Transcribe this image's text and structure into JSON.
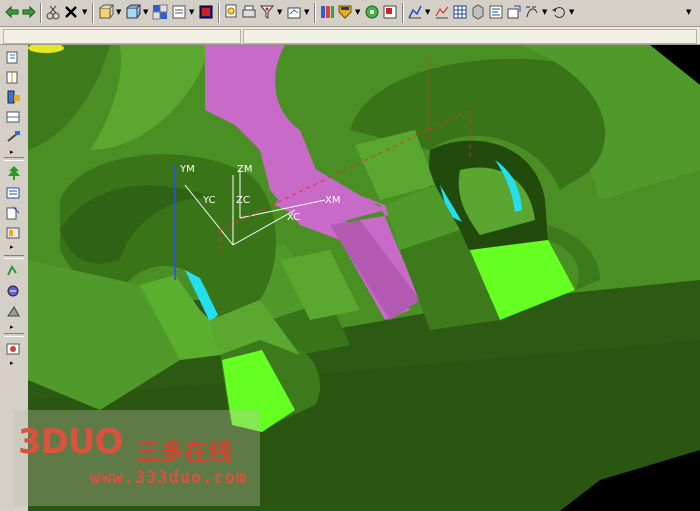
{
  "toolbar": {
    "icons": [
      "undo-icon",
      "redo-icon",
      "cut-icon",
      "delete-icon",
      "orient-view-icon",
      "fit-view-icon",
      "layer-icon",
      "display-mode-icon",
      "shading-icon",
      "zoom-icon",
      "print-icon",
      "filter-icon",
      "snap-icon",
      "column-icon",
      "material-icon",
      "web-icon",
      "edit-icon",
      "chart-icon",
      "spreadsheet-icon",
      "database-icon",
      "table-icon",
      "dimension-icon",
      "curve-icon",
      "arrow-icon"
    ]
  },
  "left_toolbar": {
    "icons": [
      "create-operation-icon",
      "create-program-icon",
      "create-tool-icon",
      "create-geometry-icon",
      "create-method-icon",
      "generate-path-icon",
      "verify-path-icon",
      "post-process-icon",
      "shop-doc-icon",
      "list-icon",
      "feature-icon",
      "simulate-icon",
      "machine-icon",
      "output-icon"
    ]
  },
  "viewport": {
    "axis_labels": {
      "ym": "YM",
      "zm": "ZM",
      "yc": "YC",
      "zc": "ZC",
      "xc": "XC",
      "xm": "XM"
    },
    "colors": {
      "background": "#000000",
      "part_green": "#4f9a2a",
      "dark_green": "#2f5d17",
      "floor_green": "#2a5a12",
      "bright_green": "#66ff22",
      "magenta": "#c86ac8",
      "cyan": "#22e0f0",
      "dashed_red": "#e03030"
    }
  },
  "watermark": {
    "logo": "3DUO",
    "chinese": "三多在线",
    "url": "www.333duo.com"
  }
}
